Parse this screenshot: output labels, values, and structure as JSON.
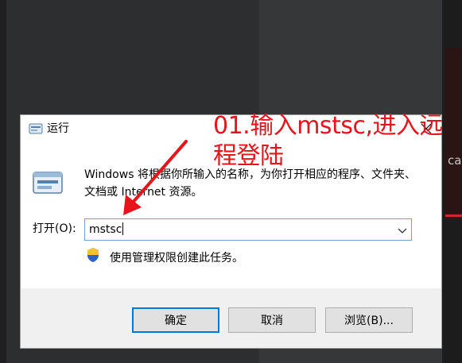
{
  "dialog": {
    "title": "运行",
    "description": "Windows 将根据你所输入的名称，为你打开相应的程序、文件夹、文档或 Internet 资源。",
    "open_label": "打开(O):",
    "input_value": "mstsc",
    "admin_note": "使用管理权限创建此任务。",
    "buttons": {
      "ok": "确定",
      "cancel": "取消",
      "browse": "浏览(B)..."
    }
  },
  "annotation": {
    "text": "01.输入mstsc,进入远程登陆",
    "color": "#e8141b"
  },
  "background": {
    "partial_text": "ca"
  },
  "icons": {
    "title": "run-icon",
    "close": "close-icon",
    "big": "run-icon",
    "dropdown": "chevron-down-icon",
    "uac": "shield-icon"
  }
}
